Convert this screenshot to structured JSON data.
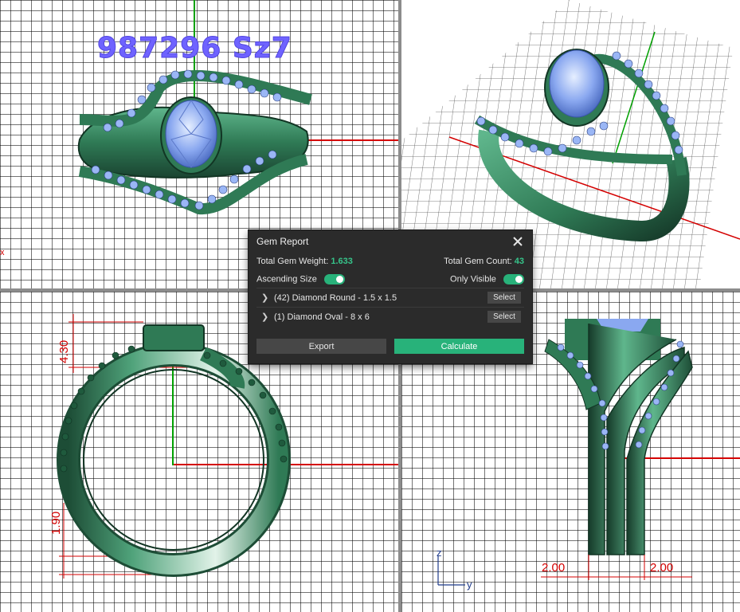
{
  "viewports": {
    "top": {
      "title": "987296 Sz7",
      "x_label": "x"
    },
    "front": {
      "dim_top": "4.30",
      "dim_bottom": "1.90"
    },
    "right": {
      "dim_left": "2.00",
      "dim_right": "2.00",
      "axis_z": "z",
      "axis_y": "y"
    }
  },
  "gem_report": {
    "title": "Gem Report",
    "total_weight_label": "Total Gem Weight:",
    "total_weight_value": "1.633",
    "total_count_label": "Total Gem Count:",
    "total_count_value": "43",
    "ascending_label": "Ascending Size",
    "ascending_on": true,
    "only_visible_label": "Only Visible",
    "only_visible_on": true,
    "items": [
      {
        "label": "(42) Diamond Round - 1.5 x 1.5",
        "select_label": "Select"
      },
      {
        "label": "(1) Diamond Oval - 8 x 6",
        "select_label": "Select"
      }
    ],
    "export_label": "Export",
    "calculate_label": "Calculate"
  },
  "colors": {
    "metal": "#2f7a55",
    "metal_dark": "#1d4d36",
    "gem": "#8aa8f0",
    "accent": "#28b27a",
    "axis_x": "#d40000",
    "axis_y": "#00a000",
    "title": "#6f63ff"
  },
  "icons": {
    "close": "close-icon",
    "expand": "chevron-right-icon"
  }
}
